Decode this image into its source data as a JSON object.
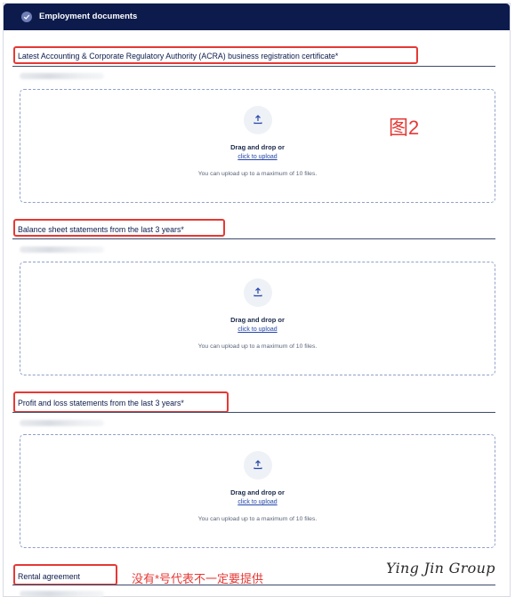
{
  "header": {
    "title": "Employment documents"
  },
  "sections": [
    {
      "label": "Latest Accounting & Corporate Regulatory Authority (ACRA) business registration certificate*"
    },
    {
      "label": "Balance sheet statements from the last 3 years*"
    },
    {
      "label": "Profit and loss statements from the last 3 years*"
    },
    {
      "label": "Rental agreement"
    }
  ],
  "dropzone": {
    "main": "Drag and drop or",
    "link": "click to upload",
    "note": "You can upload up to a maximum of 10 files."
  },
  "annotations": {
    "figure_label": "图2",
    "note": "没有*号代表不一定要提供",
    "signature": "Ying Jin Group"
  },
  "colors": {
    "header_bg": "#0d1b4c",
    "annotation_red": "#e53935",
    "dashed_border": "#8fa0c8"
  }
}
